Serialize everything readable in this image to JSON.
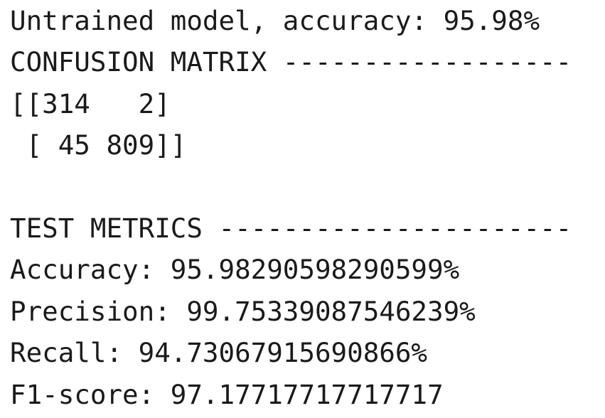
{
  "console": {
    "lines": [
      "Untrained model, accuracy: 95.98%",
      "CONFUSION MATRIX ------------------",
      "[[314   2]",
      " [ 45 809]]",
      "",
      "TEST METRICS ----------------------",
      "Accuracy: 95.98290598290599%",
      "Precision: 99.75339087546239%",
      "Recall: 94.73067915690866%",
      "F1-score: 97.17717717717717"
    ]
  },
  "colors": {
    "background": "#ffffff",
    "text": "#1a1a1a"
  }
}
